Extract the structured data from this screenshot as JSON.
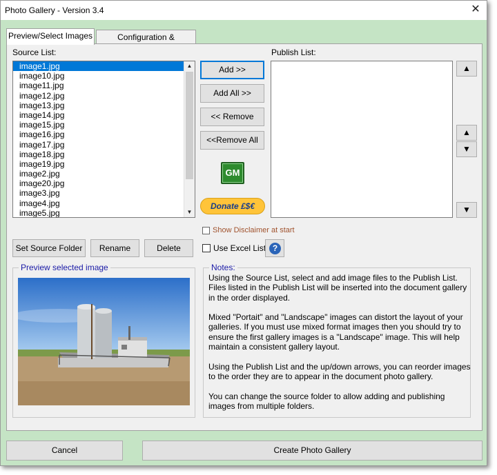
{
  "window": {
    "title": "Photo Gallery - Version 3.4",
    "close_glyph": "✕"
  },
  "tabs": [
    {
      "label": "Preview/Select Images",
      "active": true
    },
    {
      "label": "Configuration & Formatting",
      "active": false
    }
  ],
  "source_list": {
    "label": "Source List:",
    "items": [
      "image1.jpg",
      "image10.jpg",
      "image11.jpg",
      "image12.jpg",
      "image13.jpg",
      "image14.jpg",
      "image15.jpg",
      "image16.jpg",
      "image17.jpg",
      "image18.jpg",
      "image19.jpg",
      "image2.jpg",
      "image20.jpg",
      "image3.jpg",
      "image4.jpg",
      "image5.jpg"
    ],
    "selected_index": 0
  },
  "publish_list": {
    "label": "Publish List:",
    "items": []
  },
  "buttons": {
    "add": "Add >>",
    "add_all": "Add All >>",
    "remove": "<< Remove",
    "remove_all": "<<Remove All",
    "gm": "GM",
    "donate": "Donate £$€",
    "set_source_folder": "Set Source Folder",
    "rename": "Rename",
    "delete": "Delete",
    "cancel": "Cancel",
    "create": "Create Photo Gallery",
    "help": "?"
  },
  "arrows": {
    "up": "▲",
    "down": "▼"
  },
  "checkboxes": {
    "disclaimer": {
      "label": "Show Disclaimer at start",
      "checked": false,
      "color": "#a0522d"
    },
    "excel": {
      "label": "Use Excel List",
      "checked": false
    }
  },
  "preview": {
    "label": "Preview selected image",
    "label_color": "#1a1aa6"
  },
  "notes": {
    "label": "Notes:",
    "label_color": "#1a1aa6",
    "paragraphs": [
      "Using the Source List, select and add image files to the Publish List.  Files listed in the Publish List will be inserted into the document gallery in the order displayed.",
      "Mixed \"Portait\" and \"Landscape\" images can distort the layout of your galleries.  If you must use mixed format images then you should try to ensure the first gallery images is a \"Landscape\" image.  This will help maintain a consistent gallery layout.",
      "Using the Publish List and the up/down arrows, you can reorder images to  the order they are to appear in the document photo gallery.",
      "You can change the source folder to allow adding and publishing images from multiple folders."
    ]
  },
  "colors": {
    "window_bg": "#c5e4c5",
    "selection": "#0078d7",
    "focus_border": "#0078d7"
  }
}
